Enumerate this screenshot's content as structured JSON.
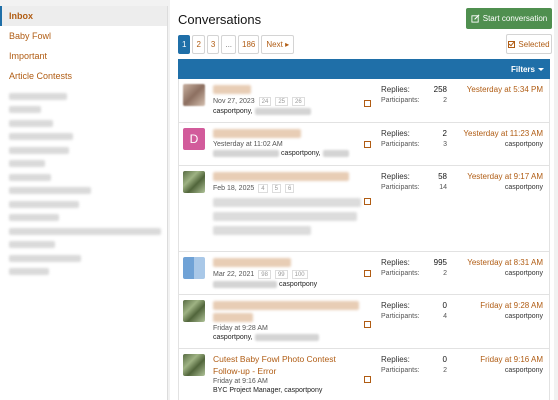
{
  "sidebar": {
    "items": [
      {
        "label": "Inbox",
        "active": true
      },
      {
        "label": "Baby Fowl",
        "active": false
      },
      {
        "label": "Important",
        "active": false
      },
      {
        "label": "Article Contests",
        "active": false
      }
    ]
  },
  "header": {
    "title": "Conversations",
    "start_label": "Start conversation",
    "selected_label": "Selected",
    "filters_label": "Filters"
  },
  "pagination": {
    "pages": [
      "1",
      "2",
      "3",
      "...",
      "186"
    ],
    "next_label": "Next"
  },
  "conversations": [
    {
      "date": "Nov 27, 2023",
      "mini_pages": [
        "24",
        "25",
        "26"
      ],
      "participants_text": "casportpony,",
      "replies": "258",
      "participants": "2",
      "last_time": "Yesterday at 5:34 PM",
      "last_user": ""
    },
    {
      "avatar_letter": "D",
      "date": "Yesterday at 11:02 AM",
      "participants_text": "casportpony,",
      "replies": "2",
      "participants": "3",
      "last_time": "Yesterday at 11:23 AM",
      "last_user": "casportpony"
    },
    {
      "date": "Feb 18, 2025",
      "mini_pages": [
        "4",
        "5",
        "6"
      ],
      "replies": "58",
      "participants": "14",
      "last_time": "Yesterday at 9:17 AM",
      "last_user": "casportpony"
    },
    {
      "date": "Mar 22, 2021",
      "mini_pages": [
        "98",
        "99",
        "100"
      ],
      "participants_text": "casportpony",
      "replies": "995",
      "participants": "2",
      "last_time": "Yesterday at 8:31 AM",
      "last_user": "casportpony"
    },
    {
      "date": "Friday at 9:28 AM",
      "participants_text": "casportpony,",
      "replies": "0",
      "participants": "4",
      "last_time": "Friday at 9:28 AM",
      "last_user": "casportpony"
    },
    {
      "title": "Cutest Baby Fowl Photo Contest Follow-up - Error",
      "date": "Friday at 9:16 AM",
      "participants_text": "BYC Project Manager, casportpony",
      "replies": "0",
      "participants": "2",
      "last_time": "Friday at 9:16 AM",
      "last_user": "casportpony"
    }
  ],
  "labels": {
    "replies": "Replies:",
    "participants": "Participants:"
  }
}
